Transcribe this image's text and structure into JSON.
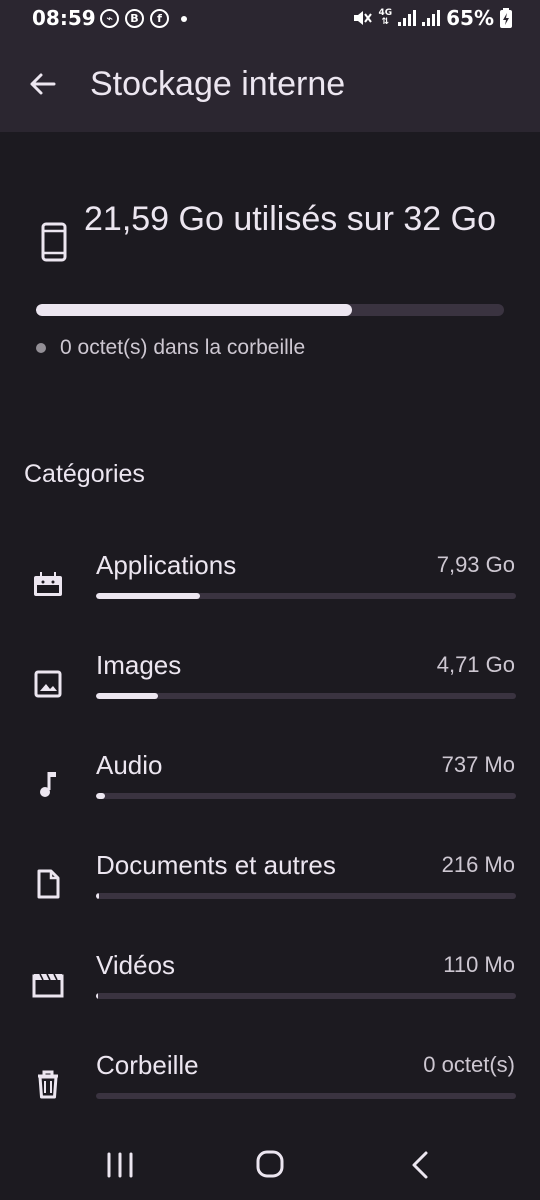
{
  "status_bar": {
    "time": "08:59",
    "app_icons": [
      "messenger-icon",
      "b-icon",
      "facebook-icon"
    ],
    "network": "4G",
    "battery": "65%"
  },
  "header": {
    "title": "Stockage interne"
  },
  "storage": {
    "used_text": "21,59 Go utilisés sur 32 Go",
    "used_fraction": 0.675,
    "trash_text": "0 octet(s) dans la corbeille"
  },
  "categories_title": "Catégories",
  "categories": [
    {
      "label": "Applications",
      "size": "7,93 Go",
      "fraction": 0.248,
      "icon": "android-icon"
    },
    {
      "label": "Images",
      "size": "4,71 Go",
      "fraction": 0.147,
      "icon": "image-icon"
    },
    {
      "label": "Audio",
      "size": "737 Mo",
      "fraction": 0.022,
      "icon": "music-note-icon"
    },
    {
      "label": "Documents et autres",
      "size": "216 Mo",
      "fraction": 0.007,
      "icon": "document-icon"
    },
    {
      "label": "Vidéos",
      "size": "110 Mo",
      "fraction": 0.004,
      "icon": "video-icon"
    },
    {
      "label": "Corbeille",
      "size": "0 octet(s)",
      "fraction": 0,
      "icon": "trash-icon"
    }
  ],
  "colors": {
    "background": "#1c1a20",
    "bar_surface": "#2b2630",
    "track": "#3a3340",
    "fill": "#ece6f0"
  }
}
